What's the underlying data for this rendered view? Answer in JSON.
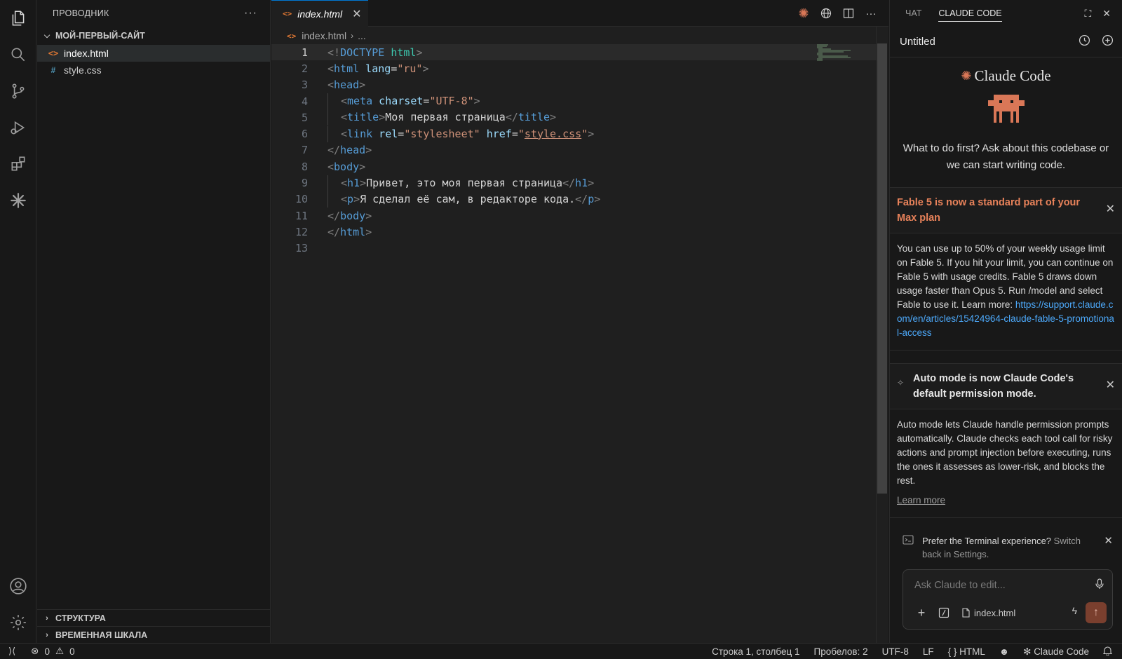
{
  "sidebar": {
    "title": "ПРОВОДНИК",
    "more": "···",
    "folder": "МОЙ-ПЕРВЫЙ-САЙТ",
    "files": [
      {
        "name": "index.html",
        "icon": "<>"
      },
      {
        "name": "style.css",
        "icon": "#"
      }
    ],
    "sections": [
      "СТРУКТУРА",
      "ВРЕМЕННАЯ ШКАЛА"
    ]
  },
  "editor": {
    "tab": "index.html",
    "breadcrumb": {
      "file": "index.html",
      "rest": "..."
    },
    "line_numbers": [
      "1",
      "2",
      "3",
      "4",
      "5",
      "6",
      "7",
      "8",
      "9",
      "10",
      "11",
      "12",
      "13"
    ],
    "code": {
      "l1": {
        "open": "<!",
        "kw": "DOCTYPE",
        "sp": " ",
        "dt": "html",
        "close": ">"
      },
      "l2": {
        "open": "<",
        "tag": "html",
        "attr": " lang",
        "eq": "=",
        "val": "\"ru\"",
        "close": ">"
      },
      "l3": {
        "open": "<",
        "tag": "head",
        "close": ">"
      },
      "l4": {
        "open": "<",
        "tag": "meta",
        "attr": " charset",
        "eq": "=",
        "val": "\"UTF-8\"",
        "close": ">"
      },
      "l5": {
        "open": "<",
        "tag": "title",
        "close": ">",
        "text": "Моя первая страница",
        "eopen": "</",
        "etag": "title",
        "eclose": ">"
      },
      "l6": {
        "open": "<",
        "tag": "link",
        "attr1": " rel",
        "eq1": "=",
        "val1": "\"stylesheet\"",
        "attr2": " href",
        "eq2": "=",
        "q1": "\"",
        "val2": "style.css",
        "q2": "\"",
        "close": ">"
      },
      "l7": {
        "open": "</",
        "tag": "head",
        "close": ">"
      },
      "l8": {
        "open": "<",
        "tag": "body",
        "close": ">"
      },
      "l9": {
        "open": "<",
        "tag": "h1",
        "close": ">",
        "text": "Привет, это моя первая страница",
        "eopen": "</",
        "etag": "h1",
        "eclose": ">"
      },
      "l10": {
        "open": "<",
        "tag": "p",
        "close": ">",
        "text": "Я сделал её сам, в редакторе кода.",
        "eopen": "</",
        "etag": "p",
        "eclose": ">"
      },
      "l11": {
        "open": "</",
        "tag": "body",
        "close": ">"
      },
      "l12": {
        "open": "</",
        "tag": "html",
        "close": ">"
      }
    }
  },
  "panel": {
    "tabs": [
      "ЧАТ",
      "CLAUDE CODE"
    ],
    "session_title": "Untitled",
    "brand": "Claude Code",
    "welcome": "What to do first? Ask about this codebase or we can start writing code.",
    "notice1": {
      "title": "Fable 5 is now a standard part of your Max plan",
      "body": "You can use up to 50% of your weekly usage limit on Fable 5. If you hit your limit, you can continue on Fable 5 with usage credits. Fable 5 draws down usage faster than Opus 5. Run /model and select Fable to use it. Learn more:",
      "link": "https://support.claude.com/en/articles/15424964-claude-fable-5-promotional-access"
    },
    "notice2": {
      "title": "Auto mode is now Claude Code's default permission mode.",
      "body": "Auto mode lets Claude handle permission prompts automatically. Claude checks each tool call for risky actions and prompt injection before executing, runs the ones it assesses as lower-risk, and blocks the rest.",
      "learn_more": "Learn more"
    },
    "terminal_tip": {
      "text": "Prefer the Terminal experience?",
      "action": "Switch back in Settings."
    },
    "composer": {
      "placeholder": "Ask Claude to edit...",
      "file": "index.html"
    }
  },
  "status": {
    "errors": "0",
    "warnings": "0",
    "position": "Строка 1, столбец 1",
    "spaces": "Пробелов: 2",
    "encoding": "UTF-8",
    "eol": "LF",
    "language": "HTML",
    "claude": "Claude Code"
  },
  "colors": {
    "accent": "#0078d4",
    "claude_orange": "#d97757",
    "notice_title": "#e8825a"
  }
}
